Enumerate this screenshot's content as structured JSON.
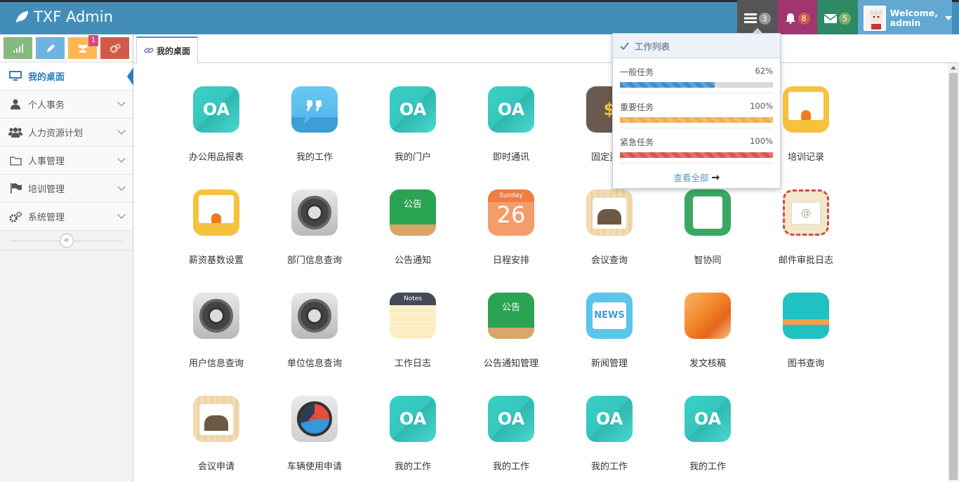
{
  "brand": {
    "title": "TXF Admin"
  },
  "navbar": {
    "tasks_count": "3",
    "notif_count": "8",
    "msg_count": "5",
    "welcome": "Welcome,",
    "username": "admin",
    "colors": {
      "bar": "#438eb9",
      "tasks": "#555555",
      "notif": "#a0366d",
      "msg": "#2e8965",
      "user": "#62a8d1"
    }
  },
  "shortcuts": [
    {
      "icon": "signal-icon",
      "color": "#87b87f"
    },
    {
      "icon": "pencil-icon",
      "color": "#6fb3e0"
    },
    {
      "icon": "users-icon",
      "color": "#ffb752",
      "badge": "1"
    },
    {
      "icon": "cogs-icon",
      "color": "#d15b47"
    }
  ],
  "sidebar": {
    "items": [
      {
        "label": "我的桌面",
        "icon": "desktop-icon",
        "active": true
      },
      {
        "label": "个人事务",
        "icon": "user-icon"
      },
      {
        "label": "人力资源计划",
        "icon": "group-icon"
      },
      {
        "label": "人事管理",
        "icon": "folder-icon"
      },
      {
        "label": "培训管理",
        "icon": "flag-icon"
      },
      {
        "label": "系统管理",
        "icon": "cogs-icon"
      }
    ]
  },
  "tab": {
    "label": "我的桌面",
    "icon": "link-icon"
  },
  "apps": [
    {
      "label": "办公用品报表",
      "icon": "oa"
    },
    {
      "label": "我的工作",
      "icon": "quote"
    },
    {
      "label": "我的门户",
      "icon": "oa"
    },
    {
      "label": "即时通讯",
      "icon": "oa"
    },
    {
      "label": "固定资产",
      "icon": "dollar"
    },
    {
      "label": "",
      "icon": "hidden"
    },
    {
      "label": "培训记录",
      "icon": "yellowdoc"
    },
    {
      "label": "薪资基数设置",
      "icon": "yellowdoc"
    },
    {
      "label": "部门信息查询",
      "icon": "gear"
    },
    {
      "label": "公告通知",
      "icon": "notice"
    },
    {
      "label": "日程安排",
      "icon": "cal"
    },
    {
      "label": "会议查询",
      "icon": "wood"
    },
    {
      "label": "智协同",
      "icon": "green"
    },
    {
      "label": "邮件审批日志",
      "icon": "mail"
    },
    {
      "label": "用户信息查询",
      "icon": "gear"
    },
    {
      "label": "单位信息查询",
      "icon": "gear"
    },
    {
      "label": "工作日志",
      "icon": "notes"
    },
    {
      "label": "公告通知管理",
      "icon": "notice"
    },
    {
      "label": "新闻管理",
      "icon": "news"
    },
    {
      "label": "发文核稿",
      "icon": "orange"
    },
    {
      "label": "图书查询",
      "icon": "book"
    },
    {
      "label": "会议申请",
      "icon": "wood"
    },
    {
      "label": "车辆使用申请",
      "icon": "gauge"
    },
    {
      "label": "我的工作",
      "icon": "oa"
    },
    {
      "label": "我的工作",
      "icon": "oa"
    },
    {
      "label": "我的工作",
      "icon": "oa"
    },
    {
      "label": "我的工作",
      "icon": "oa"
    }
  ],
  "icon_text": {
    "oa": "OA",
    "notice": "公告",
    "cal_day": "Sunday",
    "cal_num": "26",
    "notes": "Notes",
    "news": "NEWS",
    "dollar": "$",
    "mail": "@"
  },
  "tasks_dropdown": {
    "title": "工作列表",
    "items": [
      {
        "label": "一般任务",
        "percent": "62%",
        "value": 62,
        "color": "#428bca"
      },
      {
        "label": "重要任务",
        "percent": "100%",
        "value": 100,
        "color": "#f0ad4e"
      },
      {
        "label": "紧急任务",
        "percent": "100%",
        "value": 100,
        "color": "#d9534f"
      }
    ],
    "footer": "查看全部"
  }
}
